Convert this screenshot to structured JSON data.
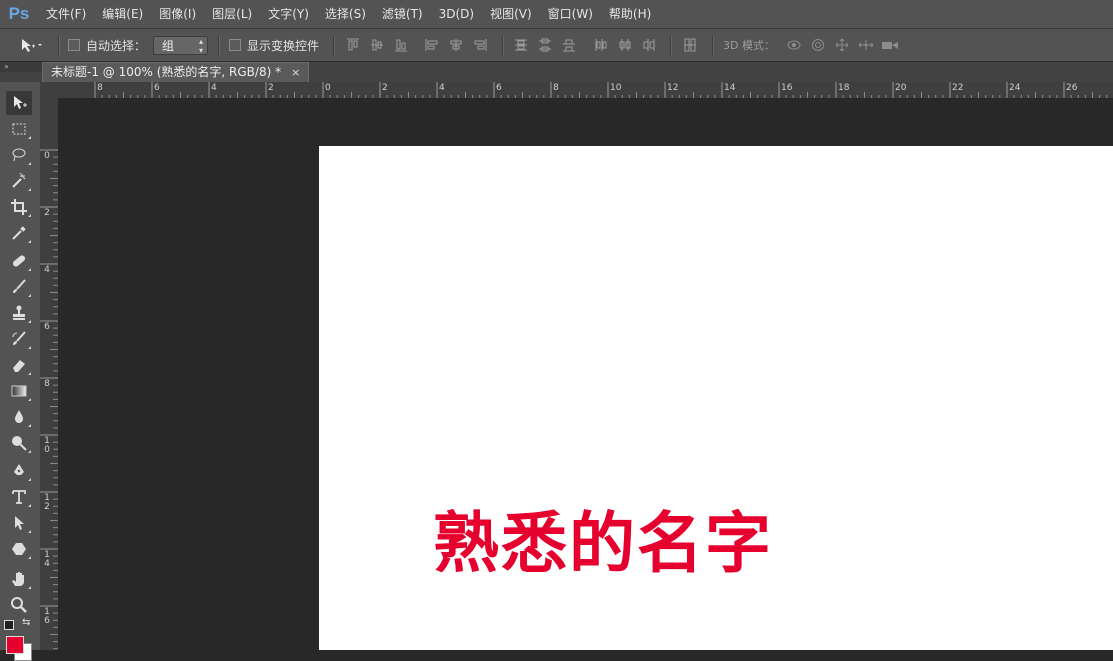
{
  "app": {
    "logo": "Ps"
  },
  "menu": [
    "文件(F)",
    "编辑(E)",
    "图像(I)",
    "图层(L)",
    "文字(Y)",
    "选择(S)",
    "滤镜(T)",
    "3D(D)",
    "视图(V)",
    "窗口(W)",
    "帮助(H)"
  ],
  "options": {
    "auto_select_label": "自动选择：",
    "auto_select_value": "组",
    "show_transform_label": "显示变换控件",
    "mode_3d_label": "3D 模式："
  },
  "document": {
    "tab_title": "未标题-1 @ 100% (熟悉的名字, RGB/8) *",
    "close": "×"
  },
  "canvas": {
    "text": "熟悉的名字",
    "text_color": "#e5002e",
    "background": "#ffffff"
  },
  "ruler_h_labels": [
    "8",
    "6",
    "4",
    "2",
    "0",
    "2",
    "4",
    "6",
    "8",
    "10",
    "12",
    "14",
    "16",
    "18",
    "20",
    "22",
    "24",
    "26"
  ],
  "ruler_v_labels": [
    "0",
    "2",
    "4",
    "6",
    "8",
    "10",
    "12",
    "14",
    "16"
  ],
  "tools": [
    "move-tool-icon",
    "marquee-tool-icon",
    "lasso-tool-icon",
    "magic-wand-tool-icon",
    "crop-tool-icon",
    "eyedropper-tool-icon",
    "healing-brush-tool-icon",
    "brush-tool-icon",
    "clone-stamp-tool-icon",
    "history-brush-tool-icon",
    "eraser-tool-icon",
    "gradient-tool-icon",
    "blur-tool-icon",
    "dodge-tool-icon",
    "pen-tool-icon",
    "type-tool-icon",
    "path-selection-tool-icon",
    "shape-tool-icon",
    "hand-tool-icon",
    "zoom-tool-icon"
  ],
  "colors": {
    "foreground": "#e5002e",
    "background": "#ffffff",
    "ui_panel": "#535353",
    "workspace": "#282828"
  }
}
